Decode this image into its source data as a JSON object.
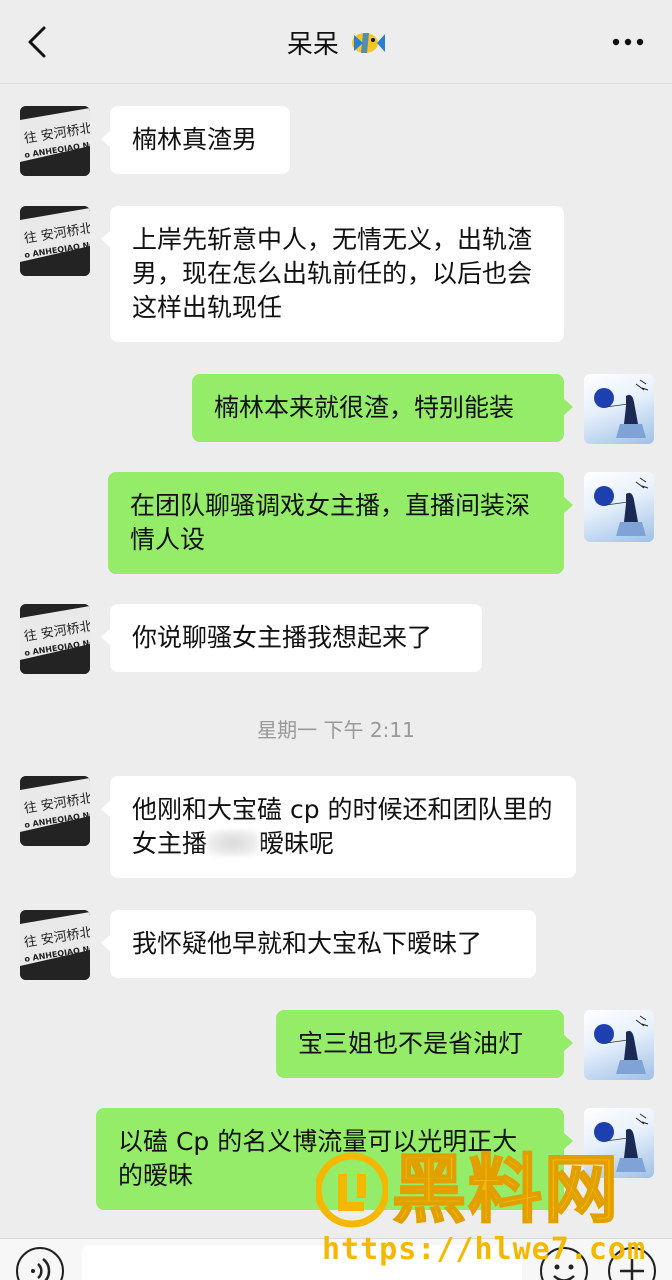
{
  "header": {
    "title": "呆呆",
    "back_icon": "chevron-left-icon",
    "more_icon": "more-dots-icon",
    "title_emoji": "tropical-fish-icon"
  },
  "avatars": {
    "contact_sign_line1": "往 安河桥北",
    "contact_sign_line2": "o ANHEQIAO North",
    "self": "girl-with-balloon-avatar"
  },
  "messages": [
    {
      "side": "left",
      "text": "楠林真渣男"
    },
    {
      "side": "left",
      "text": "上岸先斩意中人，无情无义，出轨渣男，现在怎么出轨前任的，以后也会这样出轨现任"
    },
    {
      "side": "right",
      "text": "楠林本来就很渣，特别能装"
    },
    {
      "side": "right",
      "text": "在团队聊骚调戏女主播，直播间装深情人设"
    },
    {
      "side": "left",
      "text": "你说聊骚女主播我想起来了"
    },
    {
      "side": "left",
      "text_before": "他刚和大宝磕 cp 的时候还和团队里的女主播",
      "text_after": "暧昧呢"
    },
    {
      "side": "left",
      "text": "我怀疑他早就和大宝私下暧昧了"
    },
    {
      "side": "right",
      "text": "宝三姐也不是省油灯"
    },
    {
      "side": "right",
      "text": "以磕 Cp 的名义博流量可以光明正大的暧昧"
    }
  ],
  "timestamp": "星期一 下午 2:11",
  "watermark": {
    "text": "黑料网",
    "url": "https://hlwe7.com"
  },
  "colors": {
    "background": "#ededed",
    "bubble_self": "#95ec69",
    "bubble_other": "#ffffff",
    "watermark": "#f5b800"
  }
}
